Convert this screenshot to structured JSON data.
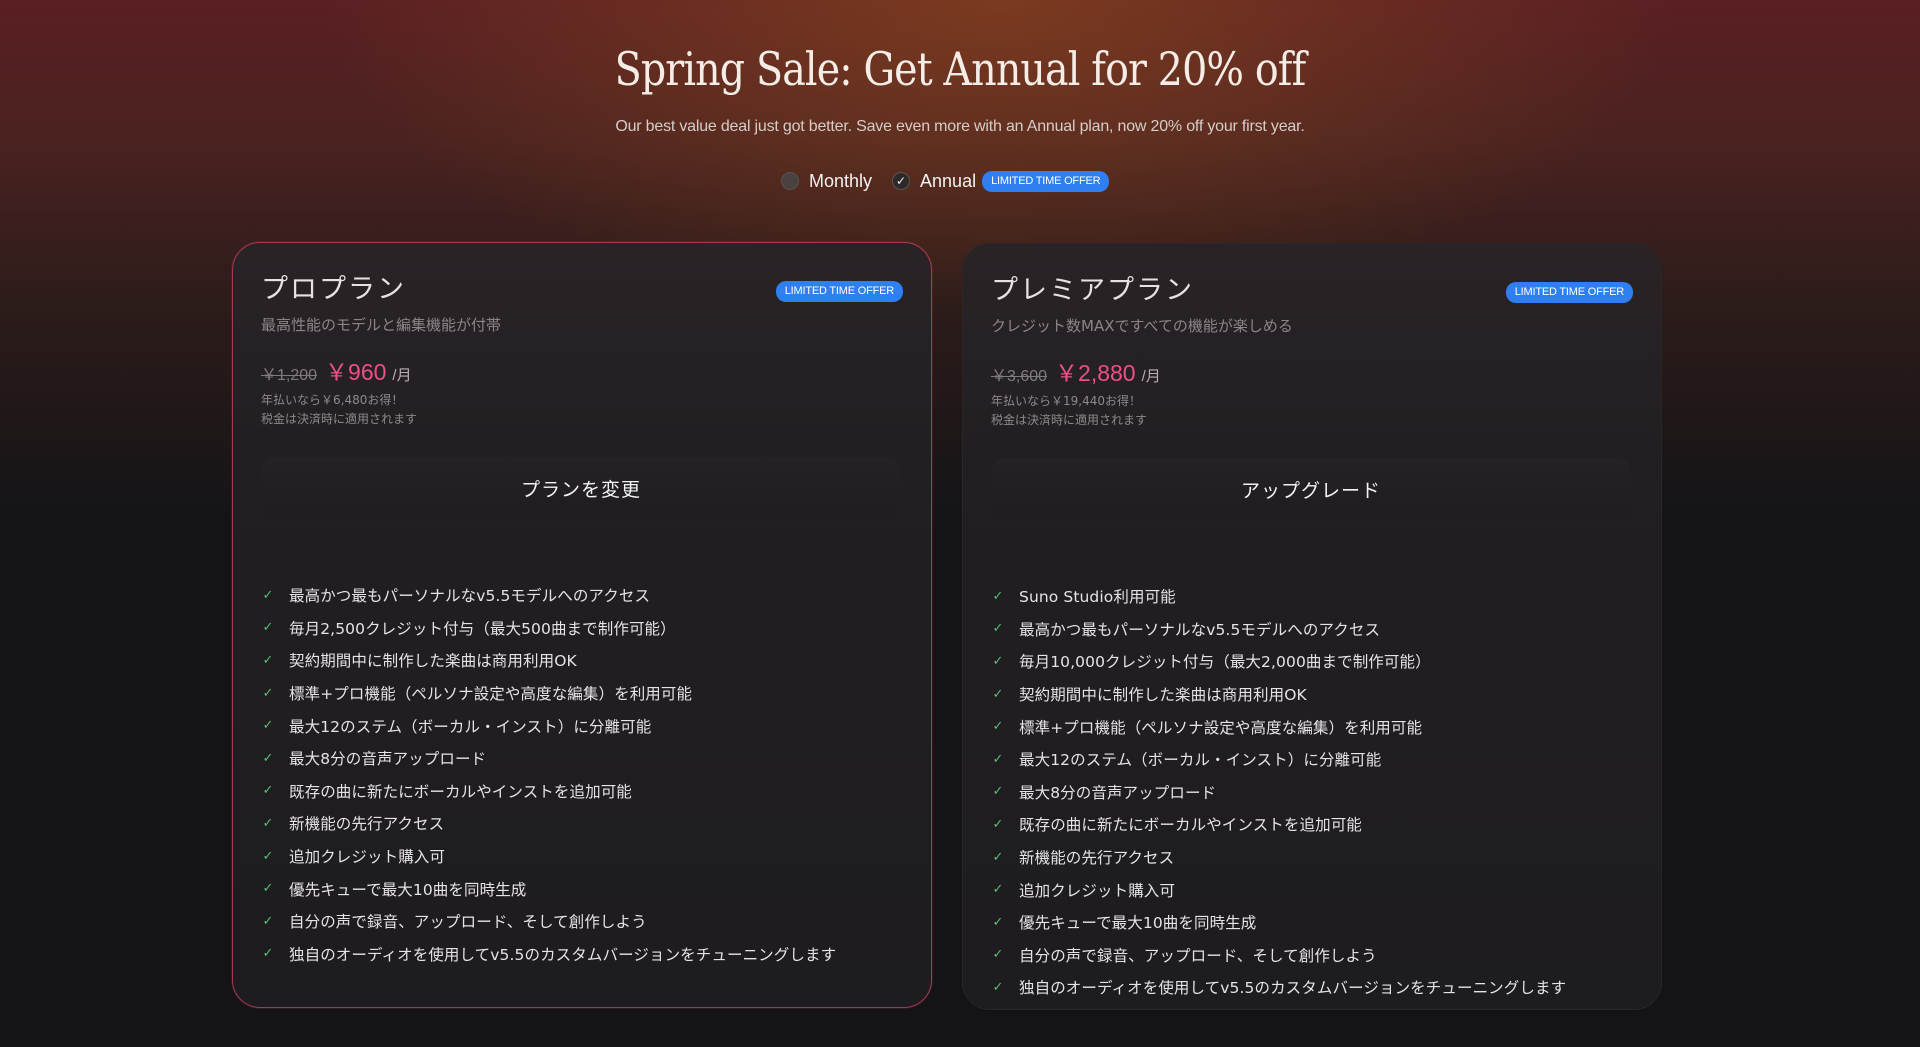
{
  "hero": {
    "title": "Spring Sale: Get Annual for 20% off",
    "subtitle": "Our best value deal just got better. Save even more with an Annual plan, now 20% off your first year."
  },
  "billing": {
    "monthly_label": "Monthly",
    "annual_label": "Annual",
    "selected": "Annual",
    "badge": "LIMITED TIME OFFER"
  },
  "colors": {
    "accent_pink": "#ee4f88",
    "badge_blue": "#2f7ff0",
    "check_green": "#58c06b"
  },
  "plans": [
    {
      "name": "プロプラン",
      "badge": "LIMITED TIME OFFER",
      "tagline": "最高性能のモデルと編集機能が付帯",
      "old_price": "￥1,200",
      "new_price": "￥960",
      "per": "/月",
      "note1": "年払いなら￥6,480お得！",
      "note2": "税金は決済時に適用されます",
      "cta": "プランを変更",
      "features": [
        "最高かつ最もパーソナルなv5.5モデルへのアクセス",
        "毎月2,500クレジット付与（最大500曲まで制作可能）",
        "契約期間中に制作した楽曲は商用利用OK",
        "標準+プロ機能（ペルソナ設定や高度な編集）を利用可能",
        "最大12のステム（ボーカル・インスト）に分離可能",
        "最大8分の音声アップロード",
        "既存の曲に新たにボーカルやインストを追加可能",
        "新機能の先行アクセス",
        "追加クレジット購入可",
        "優先キューで最大10曲を同時生成",
        "自分の声で録音、アップロード、そして創作しよう",
        "独自のオーディオを使用してv5.5のカスタムバージョンをチューニングします"
      ]
    },
    {
      "name": "プレミアプラン",
      "badge": "LIMITED TIME OFFER",
      "tagline": "クレジット数MAXですべての機能が楽しめる",
      "old_price": "￥3,600",
      "new_price": "￥2,880",
      "per": "/月",
      "note1": "年払いなら￥19,440お得！",
      "note2": "税金は決済時に適用されます",
      "cta": "アップグレード",
      "features": [
        "Suno Studio利用可能",
        "最高かつ最もパーソナルなv5.5モデルへのアクセス",
        "毎月10,000クレジット付与（最大2,000曲まで制作可能）",
        "契約期間中に制作した楽曲は商用利用OK",
        "標準+プロ機能（ペルソナ設定や高度な編集）を利用可能",
        "最大12のステム（ボーカル・インスト）に分離可能",
        "最大8分の音声アップロード",
        "既存の曲に新たにボーカルやインストを追加可能",
        "新機能の先行アクセス",
        "追加クレジット購入可",
        "優先キューで最大10曲を同時生成",
        "自分の声で録音、アップロード、そして創作しよう",
        "独自のオーディオを使用してv5.5のカスタムバージョンをチューニングします"
      ]
    }
  ]
}
